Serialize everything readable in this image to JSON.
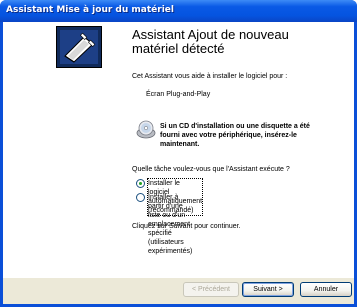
{
  "window": {
    "title": "Assistant Mise à jour du matériel"
  },
  "main": {
    "heading": "Assistant Ajout de nouveau\nmatériel détecté",
    "intro": "Cet Assistant vous aide à installer le logiciel pour :",
    "device_name": "Écran Plug-and-Play",
    "cd_message": "Si un CD d'installation ou une disquette a été\nfourni avec votre périphérique, insérez-le\nmaintenant.",
    "question": "Quelle tâche voulez-vous que l'Assistant exécute ?",
    "options": [
      {
        "label": "Installer le logiciel automatiquement (recommandé)",
        "selected": true
      },
      {
        "label": "Installer à partir d'une liste ou d'un emplacement spécifié\n(utilisateurs expérimentés)",
        "selected": false
      }
    ],
    "continue_text": "Cliquez sur Suivant pour continuer."
  },
  "buttons": {
    "back": "< Précédent",
    "next": "Suivant >",
    "cancel": "Annuler"
  },
  "colors": {
    "titlebar": "#0554e0",
    "footer": "#ece9d8",
    "radio_dot": "#21a121"
  },
  "icons": {
    "wizard": "hardware-wizard-icon",
    "cd": "cd-disc-icon"
  }
}
